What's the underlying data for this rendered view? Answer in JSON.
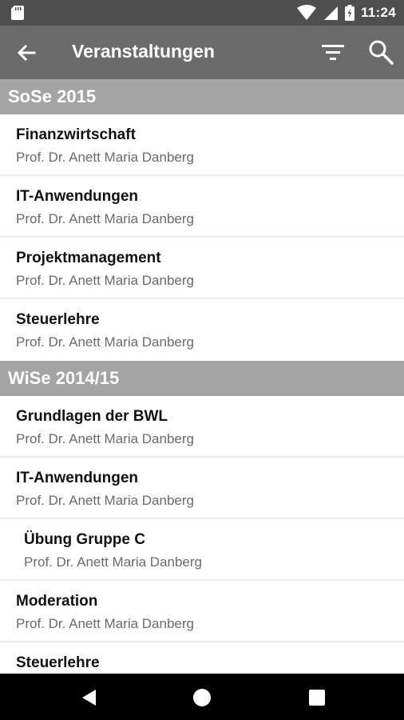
{
  "status_bar": {
    "time": "11:24",
    "icons": [
      "sd-card-icon",
      "wifi-icon",
      "signal-icon",
      "battery-icon"
    ]
  },
  "app_bar": {
    "title": "Veranstaltungen",
    "icons": [
      "back-arrow-icon",
      "filter-icon",
      "search-icon"
    ]
  },
  "sections": [
    {
      "title": "SoSe 2015",
      "items": [
        {
          "name": "Finanzwirtschaft",
          "prof": "Prof. Dr. Anett Maria Danberg"
        },
        {
          "name": "IT-Anwendungen",
          "prof": "Prof. Dr. Anett Maria Danberg"
        },
        {
          "name": "Projektmanagement",
          "prof": "Prof. Dr. Anett Maria Danberg"
        },
        {
          "name": "Steuerlehre",
          "prof": "Prof. Dr. Anett Maria Danberg"
        }
      ]
    },
    {
      "title": "WiSe 2014/15",
      "items": [
        {
          "name": "Grundlagen der BWL",
          "prof": "Prof. Dr. Anett Maria Danberg"
        },
        {
          "name": "IT-Anwendungen",
          "prof": "Prof. Dr. Anett Maria Danberg"
        },
        {
          "name": "Übung Gruppe C",
          "prof": "Prof. Dr. Anett Maria Danberg",
          "sub": true
        },
        {
          "name": "Moderation",
          "prof": "Prof. Dr. Anett Maria Danberg"
        },
        {
          "name": "Steuerlehre",
          "prof": ""
        }
      ]
    }
  ],
  "nav_bar": {
    "icons": [
      "nav-back-icon",
      "nav-home-icon",
      "nav-recents-icon"
    ]
  },
  "colors": {
    "status_bar": "#4f4f4f",
    "app_bar": "#6b6b6b",
    "section_header": "#a4a4a4",
    "nav_bar": "#000000"
  }
}
